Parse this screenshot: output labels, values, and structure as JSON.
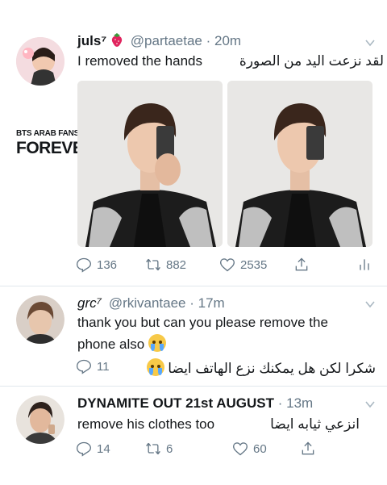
{
  "tweet1": {
    "name": "juls⁷",
    "handle": "@partaetae",
    "time": "20m",
    "text_en": "I removed the hands",
    "text_ar": "لقد نزعت اليد من الصورة",
    "watermark_line1": "BTS ARAB FANS ARMY",
    "watermark_line2": "FOREVER",
    "replies": "136",
    "retweets": "882",
    "likes": "2535"
  },
  "tweet2": {
    "name": "grc⁷",
    "handle": "@rkivantaee",
    "time": "17m",
    "text_line1": "thank you but can you please remove the",
    "text_line2": "phone also",
    "replies": "11",
    "text_ar": "شكرا لكن هل يمكنك نزع الهاتف ايضا"
  },
  "tweet3": {
    "name": "DYNAMITE OUT 21st AUGUST",
    "time": "13m",
    "text_en": "remove his clothes too",
    "text_ar_right": "انزعي ثيابه ايضا",
    "replies": "14",
    "retweets": "6",
    "likes": "60"
  },
  "colors": {
    "text": "#14171a",
    "muted": "#657786",
    "divider": "#e1e8ed"
  },
  "icons": [
    "reply-icon",
    "retweet-icon",
    "like-icon",
    "share-icon",
    "analytics-icon",
    "chevron-down-icon",
    "strawberry-icon",
    "tearful-emoji-icon"
  ]
}
